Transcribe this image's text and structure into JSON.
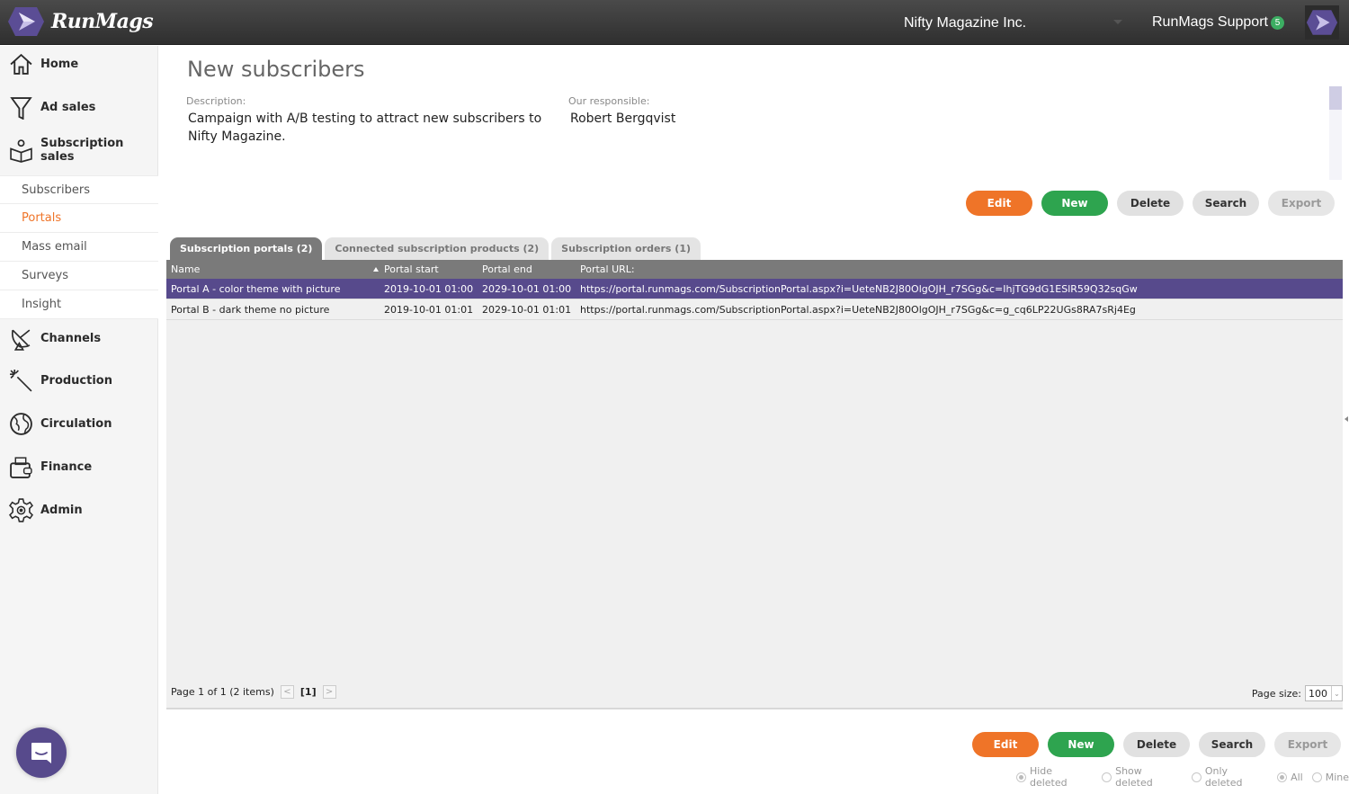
{
  "header": {
    "app_name": "RunMags",
    "company": "Nifty Magazine Inc.",
    "user_name": "RunMags Support",
    "notification_count": "5"
  },
  "sidebar": {
    "items": [
      {
        "label": "Home",
        "icon": "home-icon"
      },
      {
        "label": "Ad sales",
        "icon": "funnel-icon"
      },
      {
        "label": "Subscription sales",
        "icon": "reader-icon"
      },
      {
        "label": "Channels",
        "icon": "satellite-dish-icon"
      },
      {
        "label": "Production",
        "icon": "magic-wand-icon"
      },
      {
        "label": "Circulation",
        "icon": "globe-icon"
      },
      {
        "label": "Finance",
        "icon": "wallet-icon"
      },
      {
        "label": "Admin",
        "icon": "gear-icon"
      }
    ],
    "subitems": [
      {
        "label": "Subscribers",
        "active": false
      },
      {
        "label": "Portals",
        "active": true
      },
      {
        "label": "Mass email",
        "active": false
      },
      {
        "label": "Surveys",
        "active": false
      },
      {
        "label": "Insight",
        "active": false
      }
    ]
  },
  "page": {
    "title": "New subscribers",
    "description_label": "Description:",
    "description_line1": "Campaign with A/B testing to attract new subscribers to",
    "description_line2": "Nifty Magazine.",
    "responsible_label": "Our responsible:",
    "responsible_value": "Robert Bergqvist"
  },
  "actions": {
    "edit": "Edit",
    "new": "New",
    "delete": "Delete",
    "search": "Search",
    "export": "Export"
  },
  "tabs": [
    {
      "label": "Subscription portals (2)",
      "active": true
    },
    {
      "label": "Connected subscription products (2)",
      "active": false
    },
    {
      "label": "Subscription orders (1)",
      "active": false
    }
  ],
  "grid": {
    "columns": [
      "Name",
      "Portal start",
      "Portal end",
      "Portal URL:"
    ],
    "rows": [
      {
        "name": "Portal A - color theme with picture",
        "start": "2019-10-01 01:00",
        "end": "2029-10-01 01:00",
        "url": "https://portal.runmags.com/SubscriptionPortal.aspx?i=UeteNB2J80OlgOJH_r7SGg&c=IhjTG9dG1ESlR59Q32sqGw",
        "selected": true
      },
      {
        "name": "Portal B - dark theme no picture",
        "start": "2019-10-01 01:01",
        "end": "2029-10-01 01:01",
        "url": "https://portal.runmags.com/SubscriptionPortal.aspx?i=UeteNB2J80OlgOJH_r7SGg&c=g_cq6LP22UGs8RA7sRj4Eg",
        "selected": false
      }
    ],
    "pager_text": "Page 1 of 1 (2 items)",
    "current_page": "[1]",
    "prev": "<",
    "next": ">",
    "page_size_label": "Page size:",
    "page_size_value": "100"
  },
  "filters": [
    {
      "label": "Hide deleted",
      "checked": true
    },
    {
      "label": "Show deleted",
      "checked": false
    },
    {
      "label": "Only deleted",
      "checked": false
    },
    {
      "label": "All",
      "checked": true
    },
    {
      "label": "Mine",
      "checked": false
    }
  ]
}
